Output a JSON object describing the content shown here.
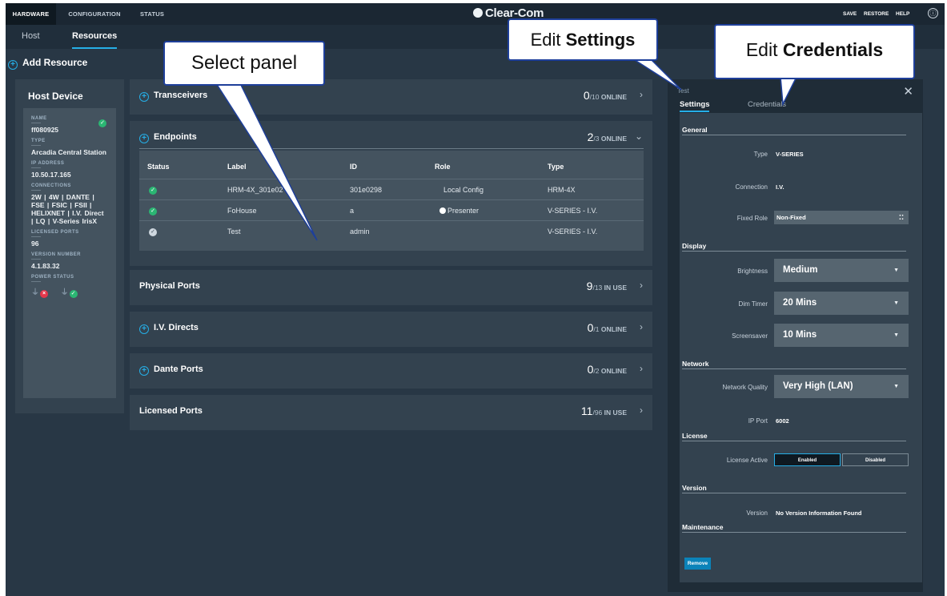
{
  "topnav": {
    "hardware": "HARDWARE",
    "configuration": "CONFIGURATION",
    "status": "STATUS",
    "brand": "Clear-Com",
    "save": "SAVE",
    "restore": "RESTORE",
    "help": "HELP",
    "help_icon": "ⓘ"
  },
  "subnav": {
    "host": "Host",
    "resources": "Resources"
  },
  "add_resource": "Add Resource",
  "host_device": {
    "title": "Host Device",
    "fields": [
      {
        "label": "NAME",
        "value": "ff080925"
      },
      {
        "label": "TYPE",
        "value": "Arcadia Central Station"
      },
      {
        "label": "IP ADDRESS",
        "value": "10.50.17.165"
      },
      {
        "label": "CONNECTIONS",
        "value": "2W | 4W | DANTE | FSE | FSIC | FSII | HELIXNET | I.V. Direct | LQ | V-Series IrisX"
      },
      {
        "label": "LICENSED PORTS",
        "value": "96"
      },
      {
        "label": "VERSION NUMBER",
        "value": "4.1.83.32"
      },
      {
        "label": "POWER STATUS",
        "value": ""
      }
    ]
  },
  "sections": {
    "transceivers": {
      "title": "Transceivers",
      "count": "0",
      "total": "/10",
      "unit": "ONLINE"
    },
    "endpoints": {
      "title": "Endpoints",
      "count": "2",
      "total": "/3",
      "unit": "ONLINE"
    },
    "physical": {
      "title": "Physical Ports",
      "count": "9",
      "total": "/13",
      "unit": "IN USE"
    },
    "ivdirects": {
      "title": "I.V. Directs",
      "count": "0",
      "total": "/1",
      "unit": "ONLINE"
    },
    "dante": {
      "title": "Dante Ports",
      "count": "0",
      "total": "/2",
      "unit": "ONLINE"
    },
    "licensed": {
      "title": "Licensed Ports",
      "count": "11",
      "total": "/96",
      "unit": "IN USE"
    }
  },
  "endpoints_table": {
    "headers": {
      "status": "Status",
      "label": "Label",
      "id": "ID",
      "role": "Role",
      "type": "Type"
    },
    "rows": [
      {
        "label": "HRM-4X_301e02",
        "id": "301e0298",
        "role": "Local Config",
        "type": "HRM-4X"
      },
      {
        "label": "FoHouse",
        "id": "a",
        "role": "Presenter",
        "type": "V-SERIES - I.V."
      },
      {
        "label": "Test",
        "id": "admin",
        "role": "",
        "type": "V-SERIES - I.V."
      }
    ]
  },
  "panel": {
    "title": "Test",
    "tabs": {
      "settings": "Settings",
      "credentials": "Credentials"
    },
    "groups": {
      "general": "General",
      "display": "Display",
      "network": "Network",
      "license": "License",
      "version": "Version",
      "maintenance": "Maintenance"
    },
    "fields": {
      "type_label": "Type",
      "type_value": "V-SERIES",
      "connection_label": "Connection",
      "connection_value": "I.V.",
      "fixedrole_label": "Fixed Role",
      "fixedrole_value": "Non-Fixed",
      "brightness_label": "Brightness",
      "brightness_value": "Medium",
      "dimtimer_label": "Dim Timer",
      "dimtimer_value": "20 Mins",
      "screensaver_label": "Screensaver",
      "screensaver_value": "10 Mins",
      "netq_label": "Network Quality",
      "netq_value": "Very High (LAN)",
      "ipport_label": "IP Port",
      "ipport_value": "6002",
      "license_label": "License Active",
      "enabled": "Enabled",
      "disabled": "Disabled",
      "version_label": "Version",
      "version_value": "No Version Information Found"
    },
    "remove": "Remove"
  },
  "callouts": {
    "select_panel": "Select panel",
    "edit_settings_prefix": "Edit ",
    "edit_settings_bold": "Settings",
    "edit_credentials_prefix": "Edit ",
    "edit_credentials_bold": "Credentials"
  },
  "colors": {
    "accent": "#25aee6",
    "ok": "#2bb673",
    "error": "#e5374b",
    "callout_border": "#1e3f9a"
  }
}
